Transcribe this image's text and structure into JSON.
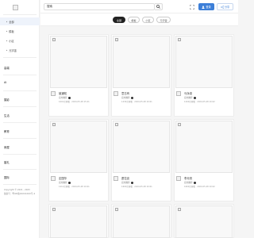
{
  "sidebar": {
    "items": [
      {
        "label": "全部",
        "sub": true,
        "active": true
      },
      {
        "label": "模板",
        "sub": true
      },
      {
        "label": "小区",
        "sub": true
      },
      {
        "label": "元宇宙",
        "sub": true
      },
      {
        "label": "高端",
        "sub": false
      },
      {
        "label": "AI",
        "sub": false
      },
      {
        "label": "摄影",
        "sub": false
      },
      {
        "label": "生活",
        "sub": false
      },
      {
        "label": "教育",
        "sub": false
      },
      {
        "label": "房屋",
        "sub": false
      },
      {
        "label": "婚礼",
        "sub": false
      },
      {
        "label": "国际",
        "sub": false
      }
    ],
    "footer_line1": "Copyright © 2021 - 2023",
    "footer_line2": "备案号：粤ICP备XXXXXXXX号-4"
  },
  "header": {
    "search_value": "搜索",
    "login_label": "登录",
    "share_label": "分享"
  },
  "filters": [
    {
      "label": "全部",
      "active": true
    },
    {
      "label": "模板"
    },
    {
      "label": "小区"
    },
    {
      "label": "元宇宙"
    }
  ],
  "cards": [
    {
      "title": "被通知",
      "owner": "官方推荐",
      "meta": "1001次观看 · 2024-05-28 15:21"
    },
    {
      "title": "意忘有",
      "owner": "官方推荐",
      "meta": "1234次观看 · 2024-05-28 10:01"
    },
    {
      "title": "马永泉",
      "owner": "官方推荐",
      "meta": "1200次观看 · 2024-05-28 10:02"
    },
    {
      "title": "定国华",
      "owner": "官方推荐",
      "meta": "1211次观看 · 2024-05-28 10:01"
    },
    {
      "title": "蘑拉克",
      "owner": "官方推荐",
      "meta": "1600次观看 · 2024-05-28 10:01"
    },
    {
      "title": "李月亮",
      "owner": "官方推荐",
      "meta": "1600次观看 · 2024-05-28 10:02"
    },
    {
      "title": "",
      "owner": "",
      "meta": ""
    },
    {
      "title": "",
      "owner": "",
      "meta": ""
    },
    {
      "title": "",
      "owner": "",
      "meta": ""
    }
  ],
  "icons": {
    "search": "search-icon",
    "settings": "settings-icon",
    "help": "help-icon",
    "login": "user-icon",
    "share": "share-icon"
  },
  "colors": {
    "accent": "#3d7fd8",
    "chip_active": "#222222"
  }
}
